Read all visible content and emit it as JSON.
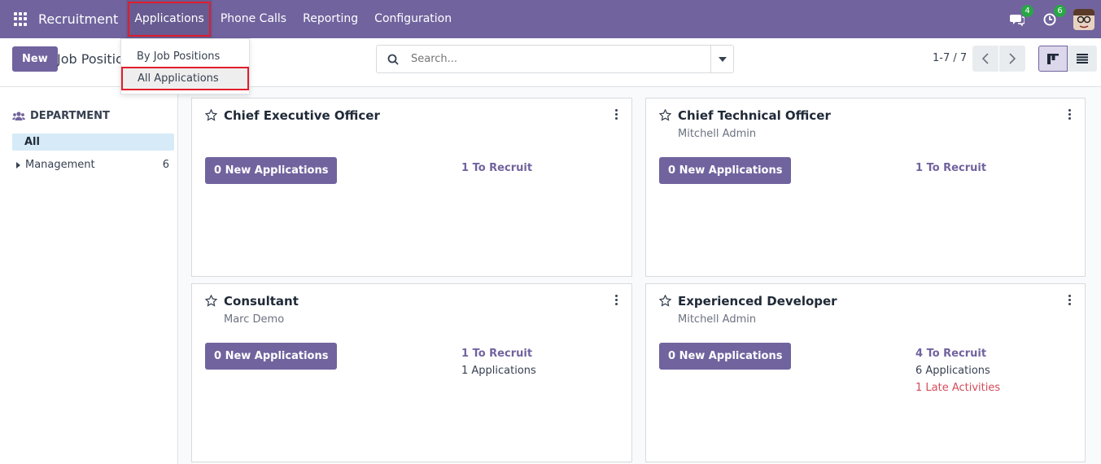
{
  "navbar": {
    "app_name": "Recruitment",
    "menu": [
      "Applications",
      "Phone Calls",
      "Reporting",
      "Configuration"
    ],
    "messages_badge": "4",
    "activities_badge": "6",
    "accent": "#71639e"
  },
  "dropdown": {
    "items": [
      "By Job Positions",
      "All Applications"
    ]
  },
  "control": {
    "new_label": "New",
    "breadcrumb": "Job Positions",
    "search_placeholder": "Search...",
    "pager": "1-7 / 7"
  },
  "sidebar": {
    "title": "DEPARTMENT",
    "all_label": "All",
    "items": [
      {
        "label": "Management",
        "count": "6"
      }
    ]
  },
  "cards": [
    {
      "title": "Chief Executive Officer",
      "subtitle": "",
      "button": "0 New Applications",
      "to_recruit": "1 To Recruit",
      "applications": "",
      "late": ""
    },
    {
      "title": "Chief Technical Officer",
      "subtitle": "Mitchell Admin",
      "button": "0 New Applications",
      "to_recruit": "1 To Recruit",
      "applications": "",
      "late": ""
    },
    {
      "title": "Consultant",
      "subtitle": "Marc Demo",
      "button": "0 New Applications",
      "to_recruit": "1 To Recruit",
      "applications": "1 Applications",
      "late": ""
    },
    {
      "title": "Experienced Developer",
      "subtitle": "Mitchell Admin",
      "button": "0 New Applications",
      "to_recruit": "4 To Recruit",
      "applications": "6 Applications",
      "late": "1 Late Activities"
    }
  ]
}
